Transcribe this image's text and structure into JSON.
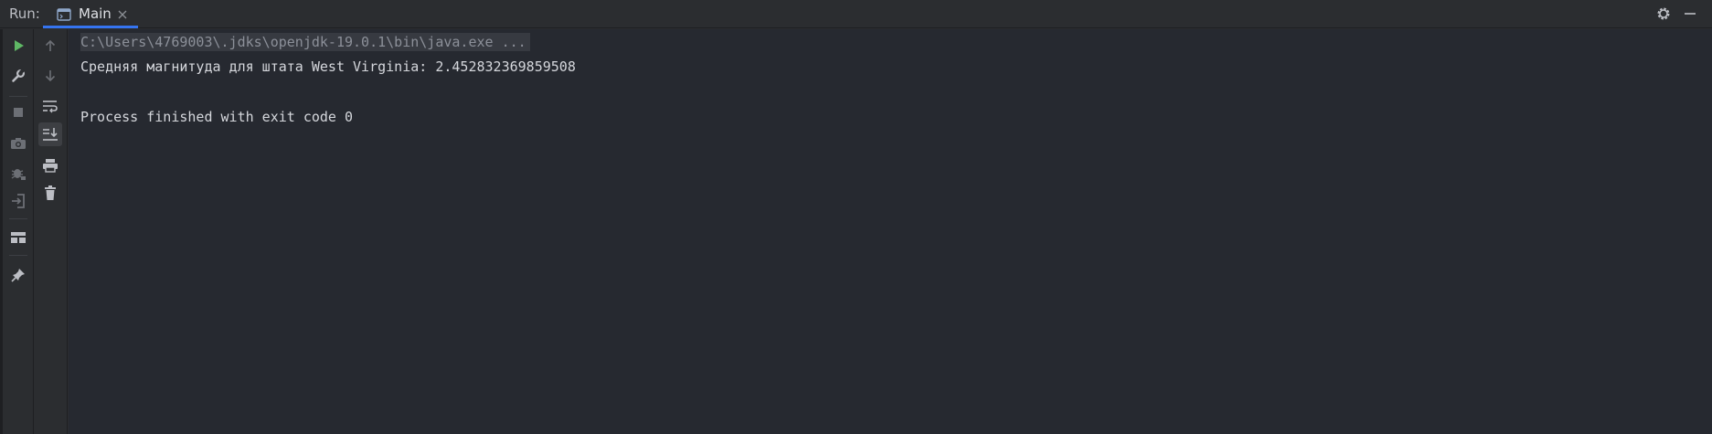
{
  "header": {
    "run_label": "Run:",
    "tab_label": "Main",
    "icons": [
      "console-tab-icon",
      "close-icon",
      "gear-icon",
      "minimize-icon"
    ]
  },
  "toolbar_primary": {
    "items": [
      "rerun-icon",
      "wrench-icon",
      "stop-icon",
      "camera-icon",
      "debug-icon",
      "login-icon",
      "layout-icon",
      "pin-icon"
    ]
  },
  "toolbar_secondary": {
    "items": [
      "arrow-up-icon",
      "arrow-down-icon",
      "soft-wrap-icon",
      "scroll-to-end-icon",
      "print-icon",
      "trash-icon"
    ]
  },
  "console": {
    "lines": [
      "C:\\Users\\4769003\\.jdks\\openjdk-19.0.1\\bin\\java.exe ...",
      "Средняя магнитуда для штата West Virginia: 2.452832369859508",
      "",
      "Process finished with exit code 0"
    ]
  },
  "colors": {
    "accent": "#3574f0",
    "run_green": "#5fb865",
    "console_bg": "#262930",
    "panel_bg": "#2b2d30"
  }
}
